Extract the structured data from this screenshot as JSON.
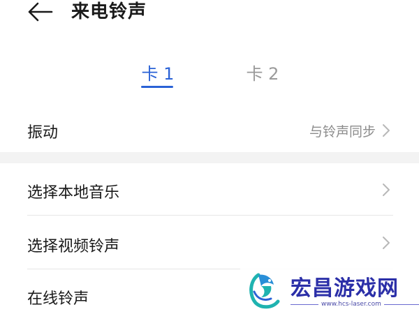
{
  "header": {
    "back_icon": "arrow-left-icon",
    "title": "来电铃声"
  },
  "tabs": [
    {
      "label": "卡 1",
      "selected": true
    },
    {
      "label": "卡 2",
      "selected": false
    }
  ],
  "colors": {
    "accent": "#2a62d6",
    "inactive_tab": "#9a9a9a",
    "secondary_text": "#8c8c8c",
    "section_gap": "#f3f3f3",
    "watermark": "#2b2fa8"
  },
  "settings": {
    "vibration": {
      "label": "振动",
      "value": "与铃声同步",
      "icon": "chevron-right-icon"
    },
    "items": [
      {
        "label": "选择本地音乐",
        "icon": "chevron-right-icon"
      },
      {
        "label": "选择视频铃声",
        "icon": "chevron-right-icon"
      },
      {
        "label": "在线铃声"
      }
    ]
  },
  "watermark": {
    "name": "宏昌游戏网",
    "url": "www.hcs-laser.com",
    "icon": "dragon-logo-icon"
  }
}
